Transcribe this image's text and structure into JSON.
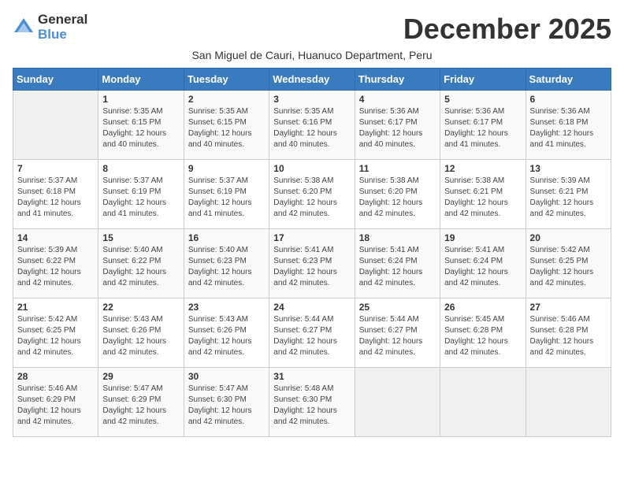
{
  "logo": {
    "text_general": "General",
    "text_blue": "Blue"
  },
  "title": "December 2025",
  "subtitle": "San Miguel de Cauri, Huanuco Department, Peru",
  "days_of_week": [
    "Sunday",
    "Monday",
    "Tuesday",
    "Wednesday",
    "Thursday",
    "Friday",
    "Saturday"
  ],
  "weeks": [
    [
      {
        "day": "",
        "sunrise": "",
        "sunset": "",
        "daylight": ""
      },
      {
        "day": "1",
        "sunrise": "Sunrise: 5:35 AM",
        "sunset": "Sunset: 6:15 PM",
        "daylight": "Daylight: 12 hours and 40 minutes."
      },
      {
        "day": "2",
        "sunrise": "Sunrise: 5:35 AM",
        "sunset": "Sunset: 6:15 PM",
        "daylight": "Daylight: 12 hours and 40 minutes."
      },
      {
        "day": "3",
        "sunrise": "Sunrise: 5:35 AM",
        "sunset": "Sunset: 6:16 PM",
        "daylight": "Daylight: 12 hours and 40 minutes."
      },
      {
        "day": "4",
        "sunrise": "Sunrise: 5:36 AM",
        "sunset": "Sunset: 6:17 PM",
        "daylight": "Daylight: 12 hours and 40 minutes."
      },
      {
        "day": "5",
        "sunrise": "Sunrise: 5:36 AM",
        "sunset": "Sunset: 6:17 PM",
        "daylight": "Daylight: 12 hours and 41 minutes."
      },
      {
        "day": "6",
        "sunrise": "Sunrise: 5:36 AM",
        "sunset": "Sunset: 6:18 PM",
        "daylight": "Daylight: 12 hours and 41 minutes."
      }
    ],
    [
      {
        "day": "7",
        "sunrise": "Sunrise: 5:37 AM",
        "sunset": "Sunset: 6:18 PM",
        "daylight": "Daylight: 12 hours and 41 minutes."
      },
      {
        "day": "8",
        "sunrise": "Sunrise: 5:37 AM",
        "sunset": "Sunset: 6:19 PM",
        "daylight": "Daylight: 12 hours and 41 minutes."
      },
      {
        "day": "9",
        "sunrise": "Sunrise: 5:37 AM",
        "sunset": "Sunset: 6:19 PM",
        "daylight": "Daylight: 12 hours and 41 minutes."
      },
      {
        "day": "10",
        "sunrise": "Sunrise: 5:38 AM",
        "sunset": "Sunset: 6:20 PM",
        "daylight": "Daylight: 12 hours and 42 minutes."
      },
      {
        "day": "11",
        "sunrise": "Sunrise: 5:38 AM",
        "sunset": "Sunset: 6:20 PM",
        "daylight": "Daylight: 12 hours and 42 minutes."
      },
      {
        "day": "12",
        "sunrise": "Sunrise: 5:38 AM",
        "sunset": "Sunset: 6:21 PM",
        "daylight": "Daylight: 12 hours and 42 minutes."
      },
      {
        "day": "13",
        "sunrise": "Sunrise: 5:39 AM",
        "sunset": "Sunset: 6:21 PM",
        "daylight": "Daylight: 12 hours and 42 minutes."
      }
    ],
    [
      {
        "day": "14",
        "sunrise": "Sunrise: 5:39 AM",
        "sunset": "Sunset: 6:22 PM",
        "daylight": "Daylight: 12 hours and 42 minutes."
      },
      {
        "day": "15",
        "sunrise": "Sunrise: 5:40 AM",
        "sunset": "Sunset: 6:22 PM",
        "daylight": "Daylight: 12 hours and 42 minutes."
      },
      {
        "day": "16",
        "sunrise": "Sunrise: 5:40 AM",
        "sunset": "Sunset: 6:23 PM",
        "daylight": "Daylight: 12 hours and 42 minutes."
      },
      {
        "day": "17",
        "sunrise": "Sunrise: 5:41 AM",
        "sunset": "Sunset: 6:23 PM",
        "daylight": "Daylight: 12 hours and 42 minutes."
      },
      {
        "day": "18",
        "sunrise": "Sunrise: 5:41 AM",
        "sunset": "Sunset: 6:24 PM",
        "daylight": "Daylight: 12 hours and 42 minutes."
      },
      {
        "day": "19",
        "sunrise": "Sunrise: 5:41 AM",
        "sunset": "Sunset: 6:24 PM",
        "daylight": "Daylight: 12 hours and 42 minutes."
      },
      {
        "day": "20",
        "sunrise": "Sunrise: 5:42 AM",
        "sunset": "Sunset: 6:25 PM",
        "daylight": "Daylight: 12 hours and 42 minutes."
      }
    ],
    [
      {
        "day": "21",
        "sunrise": "Sunrise: 5:42 AM",
        "sunset": "Sunset: 6:25 PM",
        "daylight": "Daylight: 12 hours and 42 minutes."
      },
      {
        "day": "22",
        "sunrise": "Sunrise: 5:43 AM",
        "sunset": "Sunset: 6:26 PM",
        "daylight": "Daylight: 12 hours and 42 minutes."
      },
      {
        "day": "23",
        "sunrise": "Sunrise: 5:43 AM",
        "sunset": "Sunset: 6:26 PM",
        "daylight": "Daylight: 12 hours and 42 minutes."
      },
      {
        "day": "24",
        "sunrise": "Sunrise: 5:44 AM",
        "sunset": "Sunset: 6:27 PM",
        "daylight": "Daylight: 12 hours and 42 minutes."
      },
      {
        "day": "25",
        "sunrise": "Sunrise: 5:44 AM",
        "sunset": "Sunset: 6:27 PM",
        "daylight": "Daylight: 12 hours and 42 minutes."
      },
      {
        "day": "26",
        "sunrise": "Sunrise: 5:45 AM",
        "sunset": "Sunset: 6:28 PM",
        "daylight": "Daylight: 12 hours and 42 minutes."
      },
      {
        "day": "27",
        "sunrise": "Sunrise: 5:46 AM",
        "sunset": "Sunset: 6:28 PM",
        "daylight": "Daylight: 12 hours and 42 minutes."
      }
    ],
    [
      {
        "day": "28",
        "sunrise": "Sunrise: 5:46 AM",
        "sunset": "Sunset: 6:29 PM",
        "daylight": "Daylight: 12 hours and 42 minutes."
      },
      {
        "day": "29",
        "sunrise": "Sunrise: 5:47 AM",
        "sunset": "Sunset: 6:29 PM",
        "daylight": "Daylight: 12 hours and 42 minutes."
      },
      {
        "day": "30",
        "sunrise": "Sunrise: 5:47 AM",
        "sunset": "Sunset: 6:30 PM",
        "daylight": "Daylight: 12 hours and 42 minutes."
      },
      {
        "day": "31",
        "sunrise": "Sunrise: 5:48 AM",
        "sunset": "Sunset: 6:30 PM",
        "daylight": "Daylight: 12 hours and 42 minutes."
      },
      {
        "day": "",
        "sunrise": "",
        "sunset": "",
        "daylight": ""
      },
      {
        "day": "",
        "sunrise": "",
        "sunset": "",
        "daylight": ""
      },
      {
        "day": "",
        "sunrise": "",
        "sunset": "",
        "daylight": ""
      }
    ]
  ]
}
